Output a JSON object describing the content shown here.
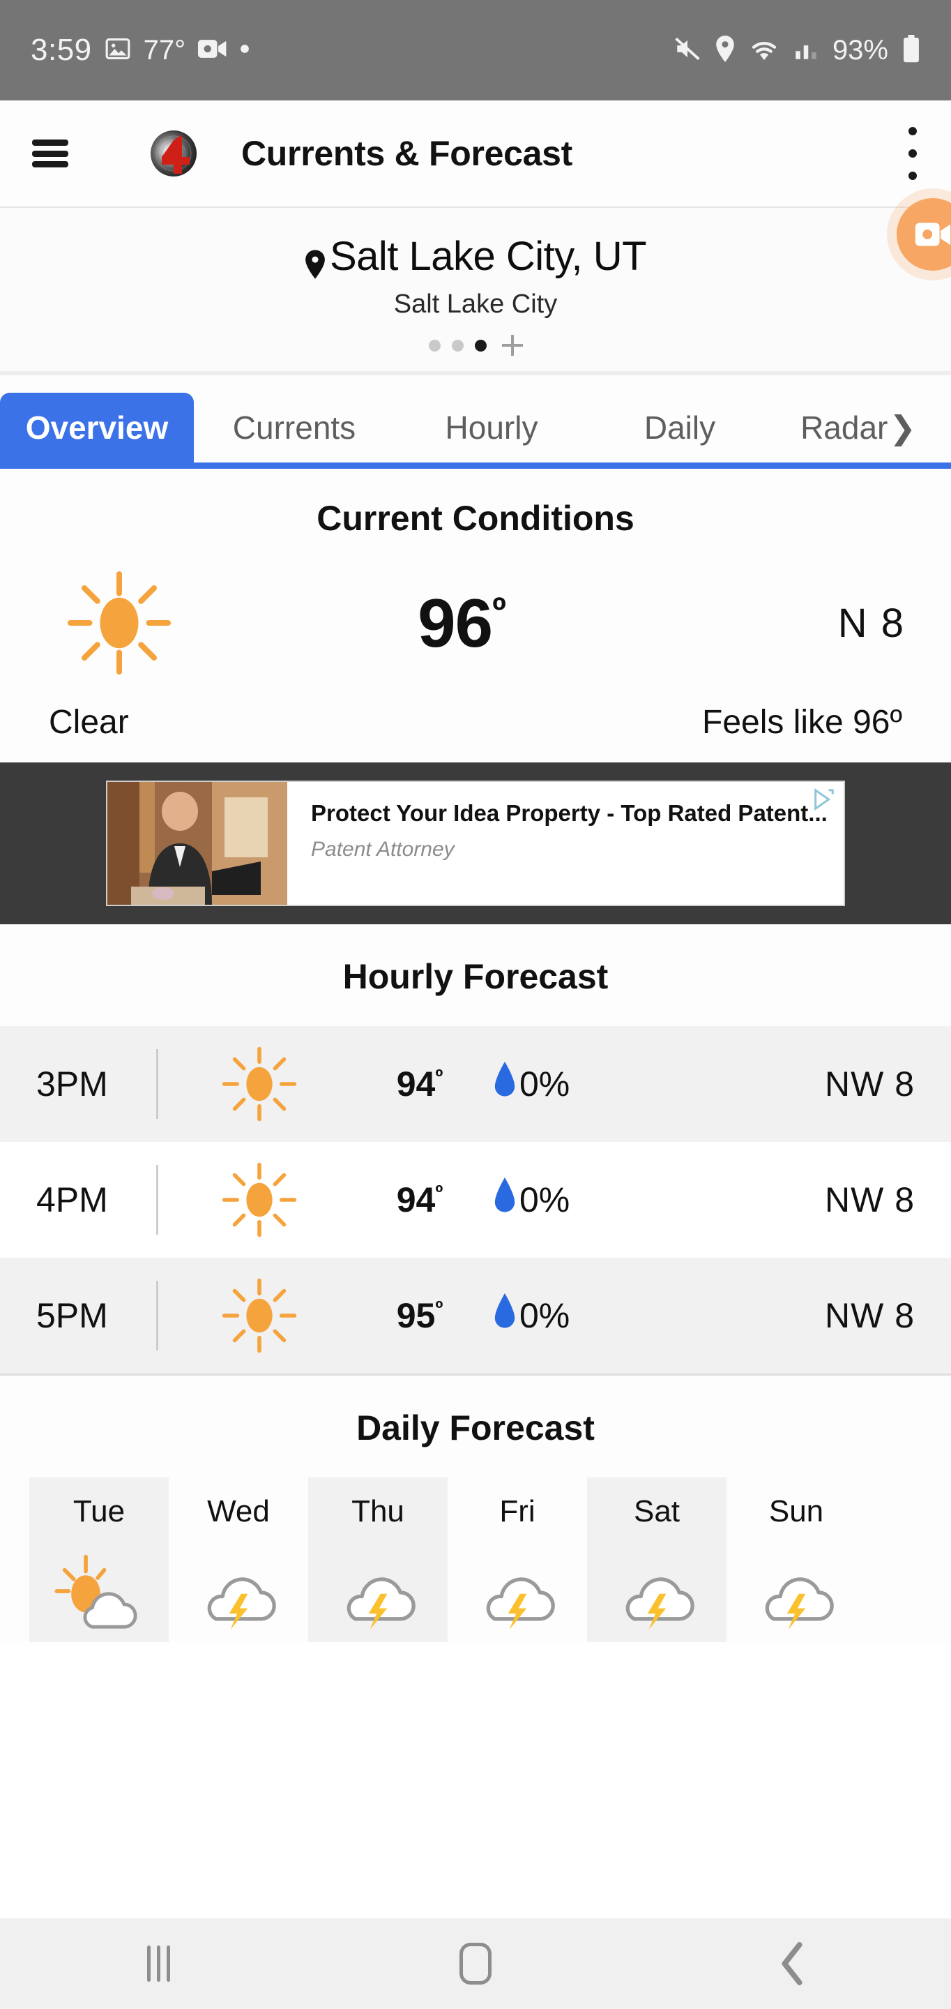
{
  "statusbar": {
    "time": "3:59",
    "temp": "77°",
    "battery": "93%",
    "icons": [
      "gallery-icon",
      "screen-record-icon",
      "dot-indicator",
      "mute-icon",
      "location-icon",
      "wifi-icon",
      "signal-icon",
      "battery-icon"
    ]
  },
  "appbar": {
    "menu_icon": "hamburger-menu-icon",
    "logo": "channel-4-logo",
    "title": "Currents & Forecast",
    "overflow_icon": "kebab-menu-icon"
  },
  "location": {
    "pin_icon": "location-pin-icon",
    "city": "Salt Lake City, UT",
    "subtitle": "Salt Lake City",
    "pager": {
      "total": 3,
      "active_index": 2,
      "add_label": "+"
    },
    "fab_icon": "video-record-icon",
    "fab_color": "#f7a763"
  },
  "tabs": {
    "active": "Overview",
    "items": [
      {
        "label": "Overview"
      },
      {
        "label": "Currents"
      },
      {
        "label": "Hourly"
      },
      {
        "label": "Daily"
      },
      {
        "label": "Radar"
      }
    ],
    "scroll_chevron": "❯",
    "active_color": "#3b72e8"
  },
  "current_conditions": {
    "title": "Current Conditions",
    "icon": "sun-clear-icon",
    "temperature": "96",
    "degree": "º",
    "wind": "N  8",
    "condition": "Clear",
    "feels_like": "Feels like 96º"
  },
  "ad": {
    "title": "Protect Your Idea Property - Top Rated Patent...",
    "subtitle": "Patent Attorney",
    "adchoices_icon": "adchoices-icon",
    "thumbnail": "businessman-at-desk-photo"
  },
  "hourly": {
    "title": "Hourly Forecast",
    "rows": [
      {
        "time": "3PM",
        "icon": "sun-icon",
        "temp": "94",
        "degree": "º",
        "precip": "0%",
        "wind": "NW  8",
        "shaded": true
      },
      {
        "time": "4PM",
        "icon": "sun-icon",
        "temp": "94",
        "degree": "º",
        "precip": "0%",
        "wind": "NW  8",
        "shaded": false
      },
      {
        "time": "5PM",
        "icon": "sun-icon",
        "temp": "95",
        "degree": "º",
        "precip": "0%",
        "wind": "NW  8",
        "shaded": true
      }
    ],
    "droplet_color": "#2a6ae0"
  },
  "daily": {
    "title": "Daily Forecast",
    "days": [
      {
        "label": "Tue",
        "icon": "partly-cloudy-icon",
        "shaded": true
      },
      {
        "label": "Wed",
        "icon": "thunderstorm-icon",
        "shaded": false
      },
      {
        "label": "Thu",
        "icon": "thunderstorm-icon",
        "shaded": true
      },
      {
        "label": "Fri",
        "icon": "thunderstorm-icon",
        "shaded": false
      },
      {
        "label": "Sat",
        "icon": "thunderstorm-icon",
        "shaded": true
      },
      {
        "label": "Sun",
        "icon": "thunderstorm-icon",
        "shaded": false
      }
    ]
  },
  "navbar": {
    "recents_icon": "recents-icon",
    "home_icon": "home-icon",
    "back_icon": "back-icon"
  },
  "colors": {
    "accent_blue": "#3b72e8",
    "sun_orange": "#f5a33c",
    "status_gray": "#757575",
    "ad_band": "#3b3b3b"
  }
}
